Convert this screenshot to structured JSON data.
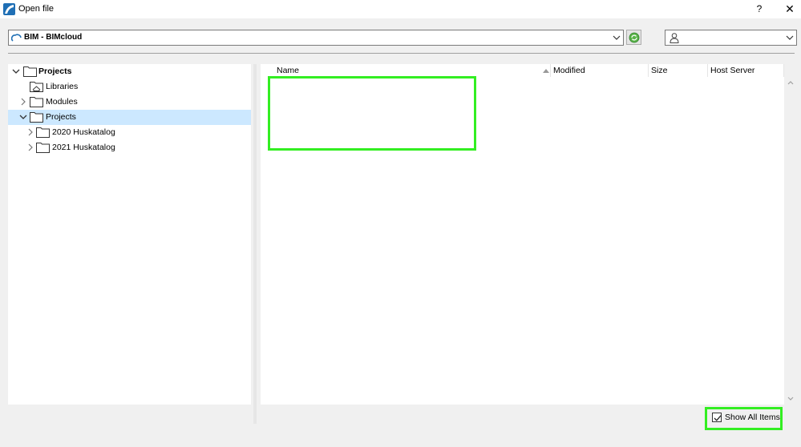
{
  "window": {
    "title": "Open file",
    "help_label": "?",
    "close_label": "✕"
  },
  "location": {
    "value": "BIM - BIMcloud"
  },
  "user_selector": {
    "value": ""
  },
  "tree": {
    "items": [
      {
        "label": "Projects",
        "bold": true,
        "expanded": true,
        "level": 0
      },
      {
        "label": "Libraries",
        "bold": false,
        "level": 1
      },
      {
        "label": "Modules",
        "bold": false,
        "expanded": false,
        "level": 1
      },
      {
        "label": "Projects",
        "bold": false,
        "expanded": true,
        "selected": true,
        "level": 1
      },
      {
        "label": "2020 Huskatalog",
        "bold": false,
        "expanded": false,
        "level": 2
      },
      {
        "label": "2021 Huskatalog",
        "bold": false,
        "expanded": false,
        "level": 2
      }
    ]
  },
  "file_list": {
    "columns": [
      {
        "label": "Name"
      },
      {
        "label": "Modified"
      },
      {
        "label": "Size"
      },
      {
        "label": "Host Server"
      }
    ],
    "rows": []
  },
  "options": {
    "show_all_items_label": "Show All Items",
    "show_all_items_checked": true
  },
  "colors": {
    "highlight": "#33ee22",
    "selection": "#cce8ff"
  }
}
